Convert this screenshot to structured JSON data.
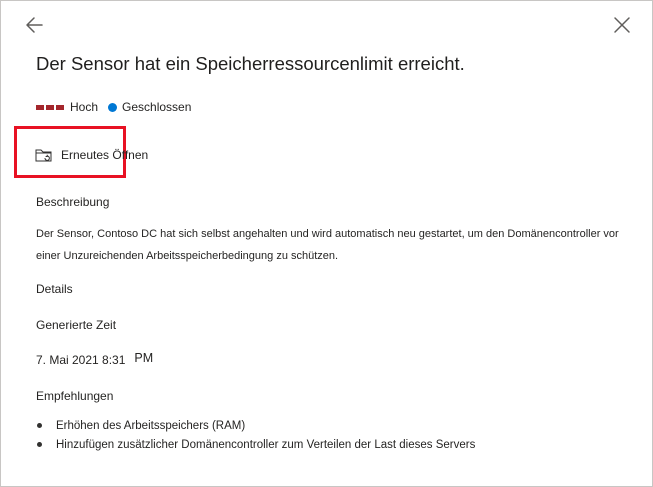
{
  "panel": {
    "title": "Der Sensor hat ein Speicherressourcenlimit erreicht.",
    "severity": "Hoch",
    "status": "Geschlossen",
    "severity_color": "#a4262c",
    "status_color": "#0078d4",
    "highlight_color": "#e81123"
  },
  "toolbar": {
    "reopen_label": "Erneutes Öffnen",
    "back_icon": "arrow-left-icon",
    "close_icon": "close-icon",
    "reopen_icon": "folder-reopen-icon"
  },
  "description": {
    "heading": "Beschreibung",
    "text": "Der Sensor, Contoso DC hat sich selbst angehalten und wird automatisch neu gestartet, um den Domänencontroller vor einer Unzureichenden Arbeitsspeicherbedingung zu schützen."
  },
  "details": {
    "heading": "Details",
    "generated_label": "Generierte Zeit",
    "generated_value": "7. Mai 2021 8:31",
    "generated_ampm": "PM"
  },
  "recommendations": {
    "heading": "Empfehlungen",
    "items": [
      "Erhöhen des Arbeitsspeichers (RAM)",
      "Hinzufügen zusätzlicher Domänencontroller zum Verteilen der Last dieses Servers"
    ]
  }
}
